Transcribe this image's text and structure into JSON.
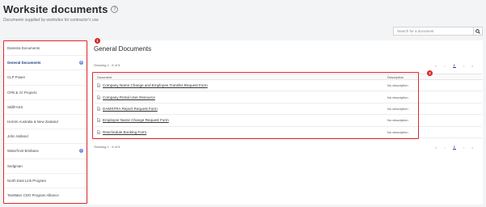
{
  "header": {
    "title": "Worksite documents",
    "help_icon": "?",
    "subtitle": "Documents supplied by worksites for contractor's use"
  },
  "search": {
    "placeholder": "Search for a document",
    "icon": "search-icon"
  },
  "sidebar": {
    "items": [
      {
        "label": "Damstra Documents",
        "active": false,
        "badge": ""
      },
      {
        "label": "General Documents",
        "active": true,
        "badge": "5"
      },
      {
        "label": "CLP Power",
        "active": false,
        "badge": ""
      },
      {
        "label": "CPB & JV Projects",
        "active": false,
        "badge": ""
      },
      {
        "label": "SkillFASS",
        "active": false,
        "badge": ""
      },
      {
        "label": "Holcim Australia & New Zealand",
        "active": false,
        "badge": ""
      },
      {
        "label": "John Holland",
        "active": false,
        "badge": ""
      },
      {
        "label": "Waterfront Brisbane",
        "active": false,
        "badge": "1"
      },
      {
        "label": "Sedgman",
        "active": false,
        "badge": ""
      },
      {
        "label": "North East Link Program",
        "active": false,
        "badge": ""
      },
      {
        "label": "TasWater CDO Program Alliance",
        "active": false,
        "badge": ""
      }
    ]
  },
  "markers": {
    "one": "1",
    "two": "2"
  },
  "main": {
    "section_title": "General Documents",
    "showing_top": "Showing 1 - 5 of 5",
    "showing_bottom": "Showing 1 - 5 of 5",
    "pagination": {
      "first": "«",
      "prev": "‹",
      "current": "1",
      "next": "›",
      "last": "»"
    },
    "table": {
      "headers": {
        "document": "Document",
        "description": "Description"
      },
      "rows": [
        {
          "document": "Company Name Change and Employee Transfer Request Form",
          "description": "No description"
        },
        {
          "document": "Company Portal User Resource",
          "description": "No description"
        },
        {
          "document": "DAMSTRA Report Request Form",
          "description": "No description"
        },
        {
          "document": "Employee Name Change Request Form",
          "description": "No description"
        },
        {
          "document": "Reschedule Booking Form",
          "description": "No description"
        }
      ]
    }
  },
  "colors": {
    "accent_red": "#e2262d",
    "link_blue": "#1f3f86",
    "badge_blue": "#6d8be0"
  }
}
